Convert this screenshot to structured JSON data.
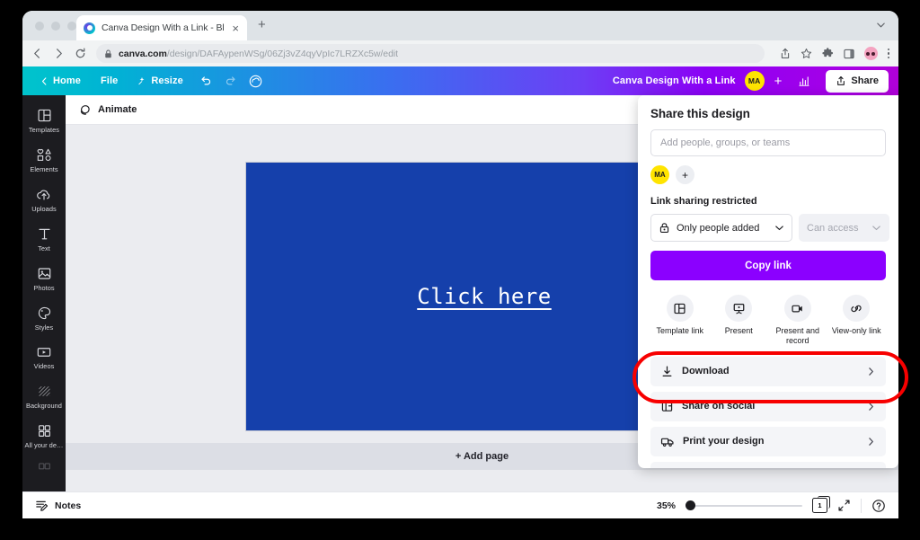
{
  "browser": {
    "tab": {
      "title": "Canva Design With a Link - Blo",
      "close_label": "×"
    },
    "new_tab_label": "+",
    "url_domain": "canva.com",
    "url_path": "/design/DAFAypenWSg/06Zj3vZ4qyVpIc7LRZXc5w/edit"
  },
  "canva_header": {
    "home": "Home",
    "file": "File",
    "resize": "Resize",
    "doc_title": "Canva Design With a Link",
    "avatar_initials": "MA",
    "plus_label": "+",
    "share_label": "Share"
  },
  "sidebar": {
    "items": [
      {
        "label": "Templates",
        "icon": "templates-icon"
      },
      {
        "label": "Elements",
        "icon": "elements-icon"
      },
      {
        "label": "Uploads",
        "icon": "uploads-icon"
      },
      {
        "label": "Text",
        "icon": "text-icon"
      },
      {
        "label": "Photos",
        "icon": "photos-icon"
      },
      {
        "label": "Styles",
        "icon": "styles-icon"
      },
      {
        "label": "Videos",
        "icon": "videos-icon"
      },
      {
        "label": "Background",
        "icon": "background-icon"
      },
      {
        "label": "All your de…",
        "icon": "all-your-designs-icon"
      }
    ]
  },
  "toolbar": {
    "animate_label": "Animate"
  },
  "canvas": {
    "link_text": "Click here",
    "page_background": "#1540ab",
    "add_page_label": "+ Add page"
  },
  "bottombar": {
    "notes_label": "Notes",
    "zoom_level": "35%",
    "page_number": "1"
  },
  "share_panel": {
    "title": "Share this design",
    "input_placeholder": "Add people, groups, or teams",
    "avatar_initials": "MA",
    "add_person_label": "+",
    "link_status": "Link sharing restricted",
    "access_who": "Only people added",
    "access_level": "Can access",
    "copy_link_label": "Copy link",
    "copy_link_color": "#8b00ff",
    "quick_actions": [
      {
        "label": "Template link",
        "icon": "template-link-icon"
      },
      {
        "label": "Present",
        "icon": "present-icon"
      },
      {
        "label": "Present and record",
        "icon": "present-and-record-icon"
      },
      {
        "label": "View-only link",
        "icon": "view-only-link-icon"
      }
    ],
    "rows": [
      {
        "label": "Download",
        "icon": "download-icon"
      },
      {
        "label": "Share on social",
        "icon": "share-on-social-icon"
      },
      {
        "label": "Print your design",
        "icon": "print-your-design-icon"
      }
    ]
  },
  "annotation": {
    "color": "#f70000",
    "target": "Download"
  }
}
